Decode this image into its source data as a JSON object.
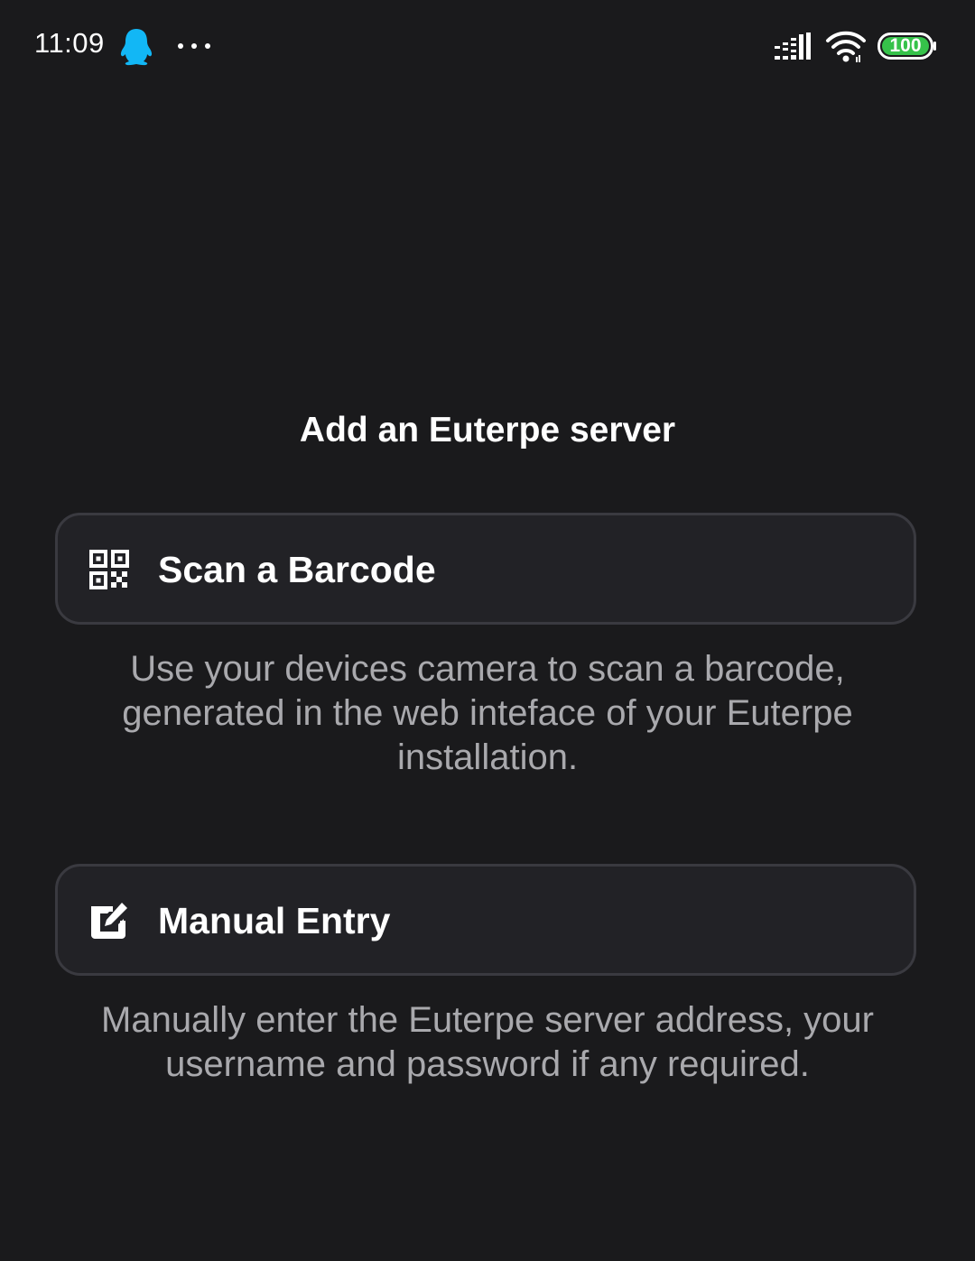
{
  "status_bar": {
    "time": "11:09",
    "battery_level": "100",
    "icons": [
      "qq-icon",
      "more-dots-icon",
      "signal-icon",
      "wifi-icon",
      "battery-icon"
    ],
    "battery_color": "#36c24a"
  },
  "main": {
    "title": "Add an Euterpe server",
    "options": [
      {
        "icon": "qr-code-icon",
        "label": "Scan a Barcode",
        "description": "Use your devices camera to scan a barcode, generated in the web inteface of your Euterpe installation."
      },
      {
        "icon": "edit-icon",
        "label": "Manual Entry",
        "description": "Manually enter the Euterpe server address, your username and password if any required."
      }
    ]
  },
  "colors": {
    "background": "#1a1a1c",
    "button_background": "#222226",
    "button_border": "#3a3a40",
    "description_text": "#a9a9ad",
    "qq_blue": "#12b7f5"
  }
}
